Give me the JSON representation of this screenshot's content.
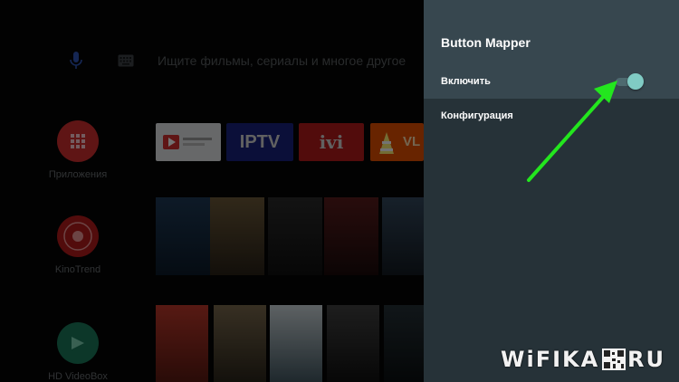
{
  "home": {
    "search": {
      "placeholder": "Ищите фильмы, сериалы и многое другое"
    },
    "sidebar_apps": [
      {
        "label": "Приложения",
        "icon": "apps-grid-icon",
        "color": "#e53935"
      },
      {
        "label": "KinoTrend",
        "icon": "kinotrend-logo",
        "color": "#c62828"
      },
      {
        "label": "HD VideoBox",
        "icon": "hd-videobox-logo",
        "color": "#1e8f6a"
      }
    ],
    "app_tiles": [
      {
        "label": "Google Play Movies",
        "icon": "google-play-movies-icon"
      },
      {
        "label": "IPTV",
        "icon": "iptv-icon"
      },
      {
        "label": "ivi",
        "icon": "ivi-icon"
      },
      {
        "label": "VL",
        "icon": "vlc-icon"
      }
    ]
  },
  "panel": {
    "title": "Button Mapper",
    "items": [
      {
        "label": "Включить",
        "toggle_on": true
      },
      {
        "label": "Конфигурация"
      }
    ]
  },
  "watermark": {
    "text_left": "WiFIKA",
    "text_right": "RU"
  },
  "colors": {
    "panel_bg": "#263238",
    "panel_header": "#37474f",
    "toggle_thumb": "#80cbc4",
    "arrow": "#23e61e"
  }
}
